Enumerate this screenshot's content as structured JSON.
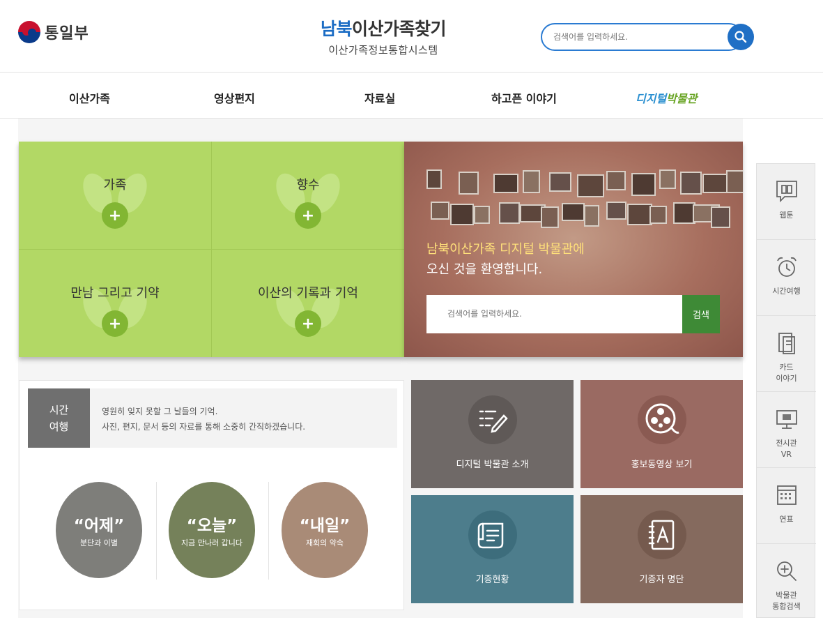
{
  "header": {
    "logo_text": "통일부",
    "title_highlight": "남북",
    "title_rest": "이산가족찾기",
    "subtitle": "이산가족정보통합시스템",
    "search_placeholder": "검색어를 입력하세요."
  },
  "nav": {
    "items": [
      {
        "label": "이산가족"
      },
      {
        "label": "영상편지"
      },
      {
        "label": "자료실"
      },
      {
        "label": "하고픈 이야기"
      }
    ],
    "special_a": "디지털",
    "special_b": "박물관"
  },
  "grid": {
    "cells": [
      {
        "label": "가족",
        "plus": "+"
      },
      {
        "label": "향수",
        "plus": "+"
      },
      {
        "label": "만남 그리고 기약",
        "plus": "+"
      },
      {
        "label": "이산의 기록과 기억",
        "plus": "+"
      }
    ]
  },
  "banner": {
    "welcome_line1": "남북이산가족 디지털 박물관에",
    "welcome_line2": "오신 것을 환영합니다.",
    "search_placeholder": "검색어를 입력하세요.",
    "search_button": "검색"
  },
  "time_travel": {
    "tag_line1": "시간",
    "tag_line2": "여행",
    "desc_line1": "영원히 잊지 못할 그 날들의 기억.",
    "desc_line2": "사진, 편지, 문서 등의 자료를 통해 소중히 간직하겠습니다.",
    "circles": [
      {
        "title": "“어제”",
        "sub": "분단과 이별",
        "color": "#7e7e7a"
      },
      {
        "title": "“오늘”",
        "sub": "지금 만나러 갑니다",
        "color": "#75815a"
      },
      {
        "title": "“내일”",
        "sub": "재회의 약속",
        "color": "#a98b77"
      }
    ]
  },
  "tiles": [
    {
      "label": "디지털 박물관 소개",
      "icon": "checklist-pen-icon",
      "color": "#6f6967"
    },
    {
      "label": "홍보동영상 보기",
      "icon": "film-reel-icon",
      "color": "#9a6a62"
    },
    {
      "label": "기증현황",
      "icon": "scroll-icon",
      "color": "#4d7d8c"
    },
    {
      "label": "기증자 명단",
      "icon": "address-book-icon",
      "color": "#856a5e"
    }
  ],
  "sidebar": {
    "items": [
      {
        "label": "웹툰",
        "icon": "book-icon"
      },
      {
        "label": "시간여행",
        "icon": "alarm-clock-icon"
      },
      {
        "label": "카드\n이야기",
        "icon": "card-icon"
      },
      {
        "label": "전시관\nVR",
        "icon": "monitor-icon"
      },
      {
        "label": "연표",
        "icon": "calendar-icon"
      },
      {
        "label": "박물관\n통합검색",
        "icon": "search-plus-icon"
      }
    ]
  }
}
